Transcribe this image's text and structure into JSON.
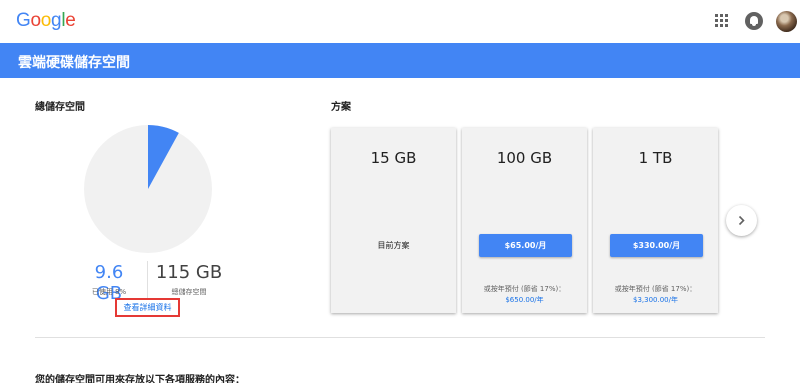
{
  "header": {
    "logo_letters": [
      {
        "char": "G",
        "color": "#4285f4"
      },
      {
        "char": "o",
        "color": "#ea4335"
      },
      {
        "char": "o",
        "color": "#fbbc05"
      },
      {
        "char": "g",
        "color": "#4285f4"
      },
      {
        "char": "l",
        "color": "#34a853"
      },
      {
        "char": "e",
        "color": "#ea4335"
      }
    ],
    "icons": [
      "apps-icon",
      "notifications-icon",
      "account-avatar"
    ]
  },
  "banner": {
    "title": "雲端硬碟儲存空間",
    "color": "#4285f4"
  },
  "storage": {
    "section_title": "總儲存空間",
    "used_value": "9.6 GB",
    "used_label": "已使用 8%",
    "used_fraction": 0.08,
    "total_value": "115 GB",
    "total_label": "總儲存空間",
    "details_link": "查看詳細資料",
    "used_color": "#4285f4",
    "free_color": "#f1f1f1"
  },
  "plans": {
    "section_title": "方案",
    "cards": [
      {
        "size": "15 GB",
        "current_label": "目前方案"
      },
      {
        "size": "100 GB",
        "price_button": "$65.00/月",
        "annual_note": "或按年預付 (節省 17%)：",
        "annual_price": "$650.00/年"
      },
      {
        "size": "1 TB",
        "price_button": "$330.00/月",
        "annual_note": "或按年預付 (節省 17%)：",
        "annual_price": "$3,300.00/年"
      }
    ],
    "next_icon": "chevron-right-icon"
  },
  "services": {
    "heading": "您的儲存空間可用來存放以下各項服務的內容："
  }
}
